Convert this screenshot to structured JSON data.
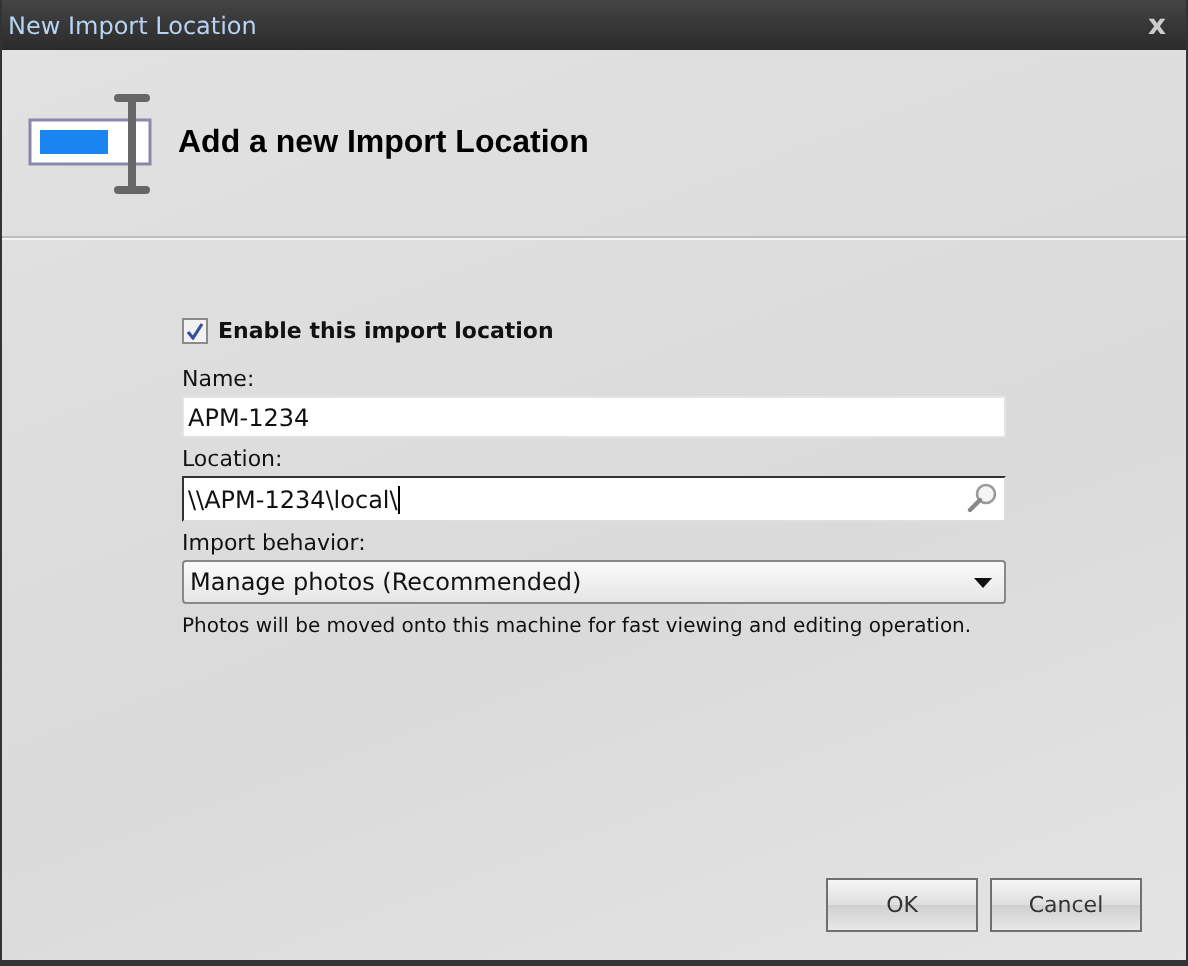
{
  "window": {
    "title": "New Import Location",
    "close": "x"
  },
  "header": {
    "title": "Add a new Import Location"
  },
  "enable": {
    "label": "Enable this import location",
    "checked": true
  },
  "fields": [
    {
      "kind": "text",
      "label": "Name:",
      "value": "APM-1234"
    },
    {
      "kind": "search",
      "label": "Location:",
      "value": "\\\\APM-1234\\local\\"
    },
    {
      "kind": "select",
      "label": "Import behavior:",
      "value": "Manage photos (Recommended)"
    }
  ],
  "help": "Photos will be moved onto this machine for fast viewing and editing operation.",
  "buttons": [
    "OK",
    "Cancel"
  ]
}
